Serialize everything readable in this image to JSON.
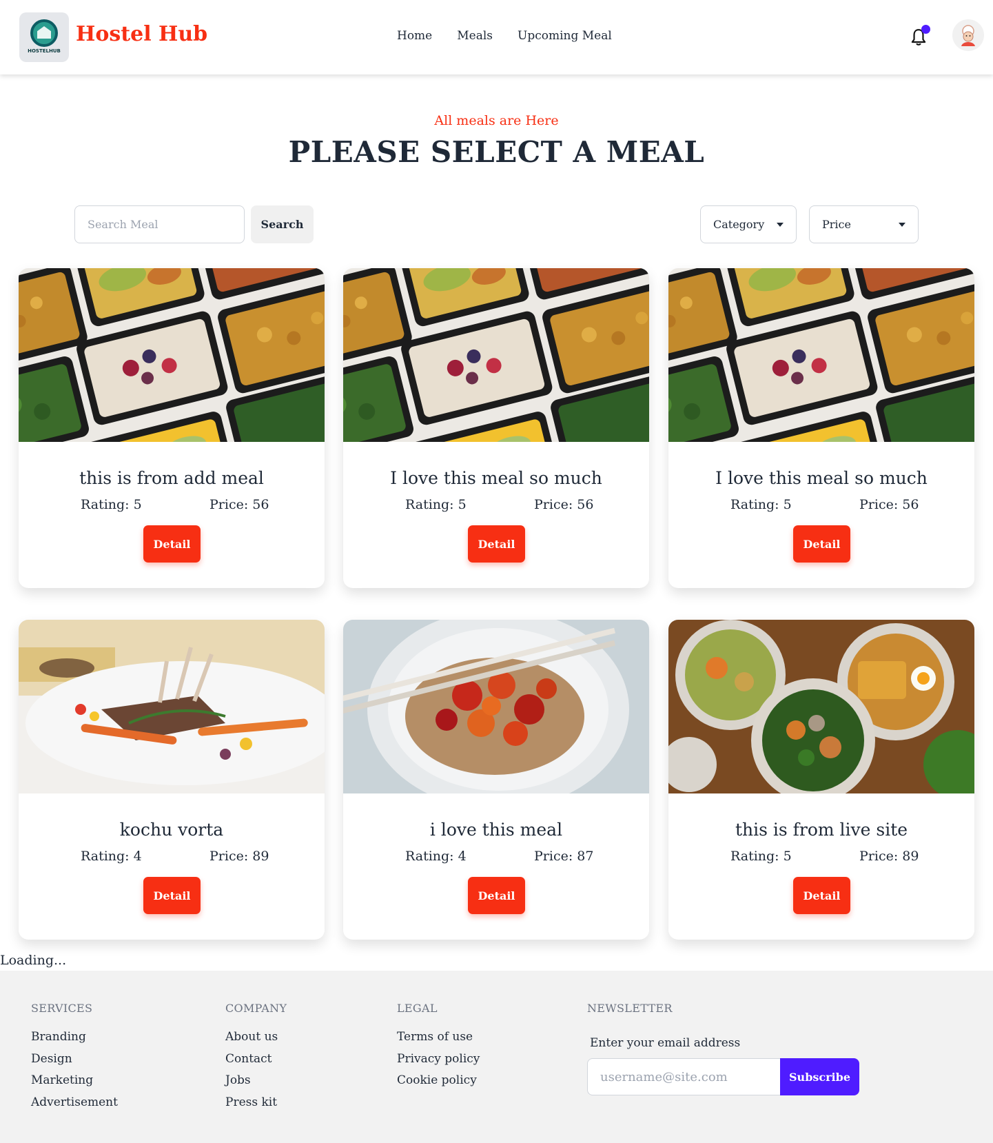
{
  "navbar": {
    "logo_text": "HOSTELHUB",
    "brand": "Hostel Hub",
    "links": [
      "Home",
      "Meals",
      "Upcoming Meal"
    ],
    "notification_dot_color": "#4f1cff"
  },
  "hero": {
    "subtitle": "All meals are Here",
    "title": "PLEASE SELECT A MEAL"
  },
  "filters": {
    "search_placeholder": "Search Meal",
    "search_value": "",
    "search_button": "Search",
    "category_label": "Category",
    "price_label": "Price"
  },
  "meals": [
    {
      "title": "this is from add meal",
      "rating_label": "Rating:",
      "rating": "5",
      "price_label": "Price:",
      "price": "56",
      "button": "Detail",
      "image": "meal-prep-boxes"
    },
    {
      "title": "I love this meal so much",
      "rating_label": "Rating:",
      "rating": "5",
      "price_label": "Price:",
      "price": "56",
      "button": "Detail",
      "image": "meal-prep-boxes"
    },
    {
      "title": "I love this meal so much",
      "rating_label": "Rating:",
      "rating": "5",
      "price_label": "Price:",
      "price": "56",
      "button": "Detail",
      "image": "meal-prep-boxes"
    },
    {
      "title": "kochu vorta",
      "rating_label": "Rating:",
      "rating": "4",
      "price_label": "Price:",
      "price": "89",
      "button": "Detail",
      "image": "lamb-chops"
    },
    {
      "title": "i love this meal",
      "rating_label": "Rating:",
      "rating": "4",
      "price_label": "Price:",
      "price": "87",
      "button": "Detail",
      "image": "rice-bowl"
    },
    {
      "title": "this is from live site",
      "rating_label": "Rating:",
      "rating": "5",
      "price_label": "Price:",
      "price": "89",
      "button": "Detail",
      "image": "brunch-spread"
    }
  ],
  "loading_text": "Loading...",
  "footer": {
    "services": {
      "heading": "SERVICES",
      "links": [
        "Branding",
        "Design",
        "Marketing",
        "Advertisement"
      ]
    },
    "company": {
      "heading": "COMPANY",
      "links": [
        "About us",
        "Contact",
        "Jobs",
        "Press kit"
      ]
    },
    "legal": {
      "heading": "LEGAL",
      "links": [
        "Terms of use",
        "Privacy policy",
        "Cookie policy"
      ]
    },
    "newsletter": {
      "heading": "NEWSLETTER",
      "label": "Enter your email address",
      "placeholder": "username@site.com",
      "button": "Subscribe"
    }
  },
  "colors": {
    "accent": "#f72f13",
    "subscribe": "#4f1cff",
    "footer_bg": "#f2f2f2"
  }
}
